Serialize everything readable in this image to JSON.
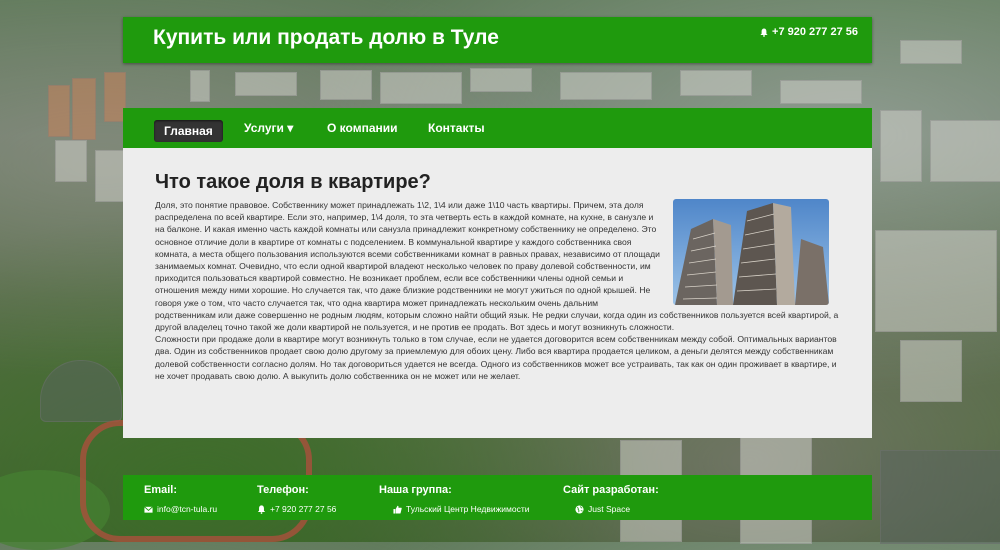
{
  "header": {
    "title": "Купить или продать долю в Туле",
    "phone": "+7 920 277 27 56"
  },
  "nav": {
    "items": [
      {
        "label": "Главная"
      },
      {
        "label": "Услуги ▾"
      },
      {
        "label": "О компании"
      },
      {
        "label": "Контакты"
      }
    ]
  },
  "main": {
    "heading": "Что такое доля в квартире?",
    "paragraphs": [
      "Доля, это понятие правовое. Собственнику может принадлежать 1\\2, 1\\4 или даже 1\\10 часть квартиры. Причем, эта доля распределена по всей квартире. Если это, например, 1\\4 доля, то эта четверть есть в каждой комнате, на кухне, в санузле и на балконе. И какая именно часть каждой комнаты или санузла принадлежит конкретному собственнику не определено. Это основное отличие доли в квартире от комнаты с подселением. В коммунальной квартире у каждого собственника своя комната, а места общего пользования используются всеми собственниками комнат в равных правах, независимо от площади занимаемых комнат. Очевидно, что если одной квартирой владеют несколько человек по праву долевой собственности, им приходится пользоваться квартирой совместно. Не возникает проблем, если все собственники члены одной семьи и отношения между ними хорошие. Но случается так, что даже близкие родственники не могут ужиться по одной крышей. Не говоря уже о том, что часто случается так, что одна квартира может принадлежать нескольким очень дальним родственникам или даже совершенно не родным людям, которым сложно найти общий язык. Не редки случаи, когда один из собственников пользуется всей квартирой, а другой владелец точно такой же доли квартирой не пользуется, и не против ее продать. Вот здесь и могут возникнуть сложности.",
      "Сложности при продаже доли в квартире могут возникнуть только в том случае, если не удается договорится всем собственникам между собой. Оптимальных вариантов два. Один из собственников продает свою долю другому за приемлемую для обоих цену. Либо вся квартира продается целиком, а деньги делятся между собственникам долевой собственности согласно долям. Но так договориться удается не всегда. Одного из собственников может все устраивать, так как он один проживает в квартире, и не хочет продавать свою долю. А выкупить долю собственника он не может или не желает."
    ]
  },
  "footer": {
    "email": {
      "heading": "Email:",
      "value": "info@tcn-tula.ru",
      "icon": "envelope-icon"
    },
    "phone": {
      "heading": "Телефон:",
      "value": "+7 920 277 27 56",
      "icon": "bell-icon"
    },
    "group": {
      "heading": "Наша группа:",
      "value": "Тульский Центр Недвижимости",
      "icon": "thumbs-up-icon"
    },
    "developer": {
      "heading": "Сайт разработан:",
      "value": "Just Space",
      "icon": "globe-icon"
    }
  },
  "colors": {
    "brand_green": "#1f9a0d",
    "active_tab": "#333333",
    "content_bg": "#ededed"
  }
}
